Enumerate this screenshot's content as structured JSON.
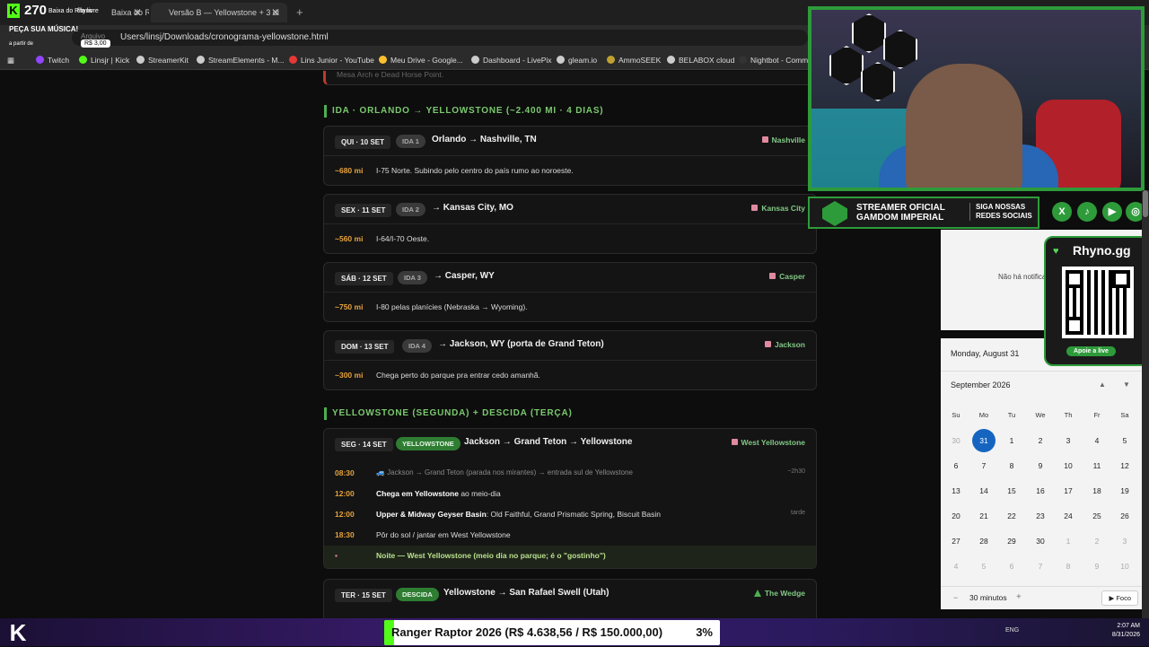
{
  "browser": {
    "tabs": [
      {
        "label": "Baixa do Rhyno • Flórida e Parque"
      },
      {
        "label": "Versão B — Yellowstone + 3 di"
      }
    ],
    "url": "Users/linsj/Downloads/cronograma-yellowstone.html",
    "file_prefix": "Arquivo",
    "bookmarks": [
      "Twitch",
      "Linsjr | Kick",
      "StreamerKit",
      "StreamElements - M...",
      "Lins Junior - YouTube",
      "Meu Drive - Google...",
      "Dashboard - LivePix",
      "gleam.io",
      "AmmoSEEK",
      "BELABOX cloud",
      "Nightbot - Comm"
    ]
  },
  "kick_overlay": {
    "count": "270",
    "channel": "Baixa do Rhyno",
    "queue": "fila livre",
    "request": "PEÇA SUA MÚSICA!",
    "from": "a partir de",
    "price": "R$ 3,00"
  },
  "prev_card_text": "Mesa Arch e Dead Horse Point.",
  "sections": [
    {
      "title": "IDA · ORLANDO → YELLOWSTONE (~2.400 MI · 4 DIAS)"
    },
    {
      "title": "YELLOWSTONE (SEGUNDA) + DESCIDA (TERÇA)"
    }
  ],
  "days": [
    {
      "date": "QUI · 10 SET",
      "tag": "IDA 1",
      "title": "Orlando → Nashville, TN",
      "location": "Nashville",
      "miles": "~680 mi",
      "desc": "I-75 Norte. Subindo pelo centro do país rumo ao noroeste."
    },
    {
      "date": "SEX · 11 SET",
      "tag": "IDA 2",
      "title": "→ Kansas City, MO",
      "location": "Kansas City",
      "miles": "~560 mi",
      "desc": "I-64/I-70 Oeste."
    },
    {
      "date": "SÁB · 12 SET",
      "tag": "IDA 3",
      "title": "→ Casper, WY",
      "location": "Casper",
      "miles": "~750 mi",
      "desc": "I-80 pelas planícies (Nebraska → Wyoming)."
    },
    {
      "date": "DOM · 13 SET",
      "tag": "IDA 4",
      "title": "→ Jackson, WY (porta de Grand Teton)",
      "location": "Jackson",
      "miles": "~300 mi",
      "desc": "Chega perto do parque pra entrar cedo amanhã."
    }
  ],
  "yellowstone_day": {
    "date": "SEG · 14 SET",
    "tag": "YELLOWSTONE",
    "title": "Jackson → Grand Teton → Yellowstone",
    "location": "West Yellowstone",
    "rows": [
      {
        "time": "08:30",
        "desc": "🚙 Jackson → Grand Teton (parada nos mirantes) → entrada sul de Yellowstone",
        "right": "~2h30"
      },
      {
        "time": "12:00",
        "bold": "Chega em Yellowstone",
        "desc": " ao meio-dia",
        "right": ""
      },
      {
        "time": "12:00",
        "bold": "Upper & Midway Geyser Basin",
        "desc": ": Old Faithful, Grand Prismatic Spring, Biscuit Basin",
        "right": "tarde"
      },
      {
        "time": "18:30",
        "bold": "",
        "desc": "Pôr do sol / jantar em West Yellowstone",
        "right": ""
      }
    ],
    "night": "Noite — West Yellowstone (meio dia no parque; é o \"gostinho\")"
  },
  "descida_day": {
    "date": "TER · 15 SET",
    "tag": "DESCIDA",
    "title": "Yellowstone → San Rafael Swell (Utah)",
    "location": "The Wedge"
  },
  "stream_overlay": {
    "banner_left": [
      "STREAMER OFICIAL",
      "GAMDOM IMPERIAL"
    ],
    "banner_right": [
      "SIGA NOSSAS",
      "REDES SOCIAIS"
    ],
    "rhyno_name": "Rhyno.gg",
    "rhyno_button": "Apoie a live"
  },
  "notifications": {
    "empty": "Não há notificações"
  },
  "calendar": {
    "today_header": "Monday, August 31",
    "month": "September 2026",
    "weekdays": [
      "Su",
      "Mo",
      "Tu",
      "We",
      "Th",
      "Fr",
      "Sa"
    ],
    "weeks": [
      [
        "30",
        "31",
        "1",
        "2",
        "3",
        "4",
        "5"
      ],
      [
        "6",
        "7",
        "8",
        "9",
        "10",
        "11",
        "12"
      ],
      [
        "13",
        "14",
        "15",
        "16",
        "17",
        "18",
        "19"
      ],
      [
        "20",
        "21",
        "22",
        "23",
        "24",
        "25",
        "26"
      ],
      [
        "27",
        "28",
        "29",
        "30",
        "1",
        "2",
        "3"
      ],
      [
        "4",
        "5",
        "6",
        "7",
        "8",
        "9",
        "10"
      ]
    ],
    "focus_minutes": "30 minutos",
    "focus_button": "Foco"
  },
  "goal": {
    "label": "Ranger Raptor 2026 (R$ 4.638,56 / R$ 150.000,00)",
    "percent_text": "3%",
    "progress": 0.03
  },
  "taskbar": {
    "time": "2:07 AM",
    "date": "8/31/2026",
    "lang": "ENG"
  },
  "colors": {
    "accent_green": "#53fc18",
    "section_green": "#7bc96f",
    "time_orange": "#e6a23c",
    "today_blue": "#1565c0"
  }
}
